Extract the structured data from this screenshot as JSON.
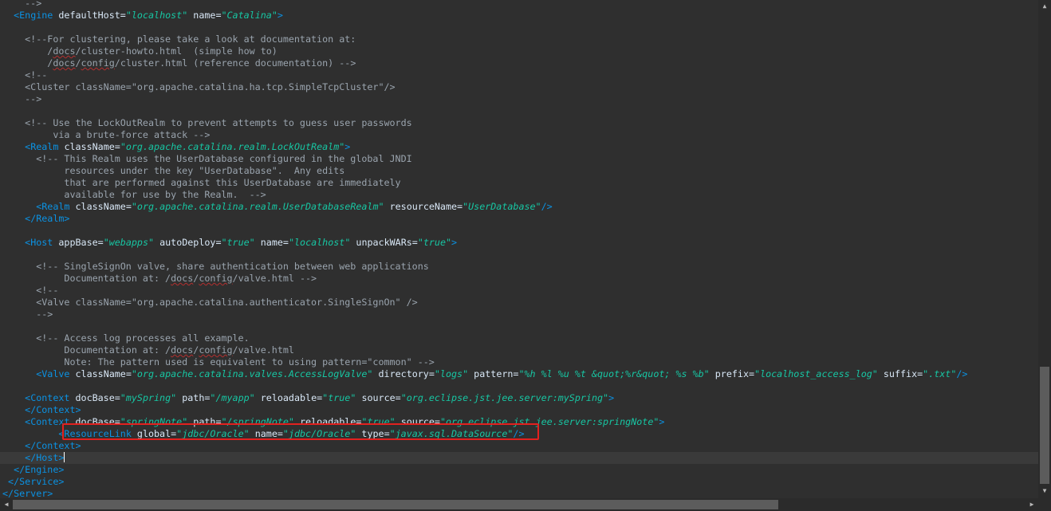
{
  "editor": {
    "lines": [
      [
        {
          "c": "ck",
          "t": "    -->"
        }
      ],
      [
        {
          "c": "t",
          "t": "  "
        },
        {
          "c": "tg",
          "t": "<Engine"
        },
        {
          "c": "t",
          "t": " "
        },
        {
          "c": "at",
          "t": "defaultHost="
        },
        {
          "c": "av",
          "t": "\"localhost\""
        },
        {
          "c": "t",
          "t": " "
        },
        {
          "c": "at",
          "t": "name="
        },
        {
          "c": "av",
          "t": "\"Catalina\""
        },
        {
          "c": "tg",
          "t": ">"
        }
      ],
      [
        {
          "c": "t",
          "t": ""
        }
      ],
      [
        {
          "c": "ck",
          "t": "    <!--For clustering, please take a look at documentation at:"
        }
      ],
      [
        {
          "c": "ck",
          "t": "        /"
        },
        {
          "c": "sq",
          "t": "docs"
        },
        {
          "c": "ck",
          "t": "/cluster-howto.html  (simple how to)"
        }
      ],
      [
        {
          "c": "ck",
          "t": "        /"
        },
        {
          "c": "sq",
          "t": "docs"
        },
        {
          "c": "ck",
          "t": "/"
        },
        {
          "c": "sq",
          "t": "config"
        },
        {
          "c": "ck",
          "t": "/cluster.html (reference documentation) -->"
        }
      ],
      [
        {
          "c": "ck",
          "t": "    <!--"
        }
      ],
      [
        {
          "c": "ck",
          "t": "    <Cluster className=\"org.apache.catalina.ha.tcp.SimpleTcpCluster\"/>"
        }
      ],
      [
        {
          "c": "ck",
          "t": "    -->"
        }
      ],
      [
        {
          "c": "t",
          "t": ""
        }
      ],
      [
        {
          "c": "ck",
          "t": "    <!-- Use the LockOutRealm to prevent attempts to guess user passwords"
        }
      ],
      [
        {
          "c": "ck",
          "t": "         via a brute-force attack -->"
        }
      ],
      [
        {
          "c": "t",
          "t": "    "
        },
        {
          "c": "tg",
          "t": "<Realm"
        },
        {
          "c": "t",
          "t": " "
        },
        {
          "c": "at",
          "t": "className="
        },
        {
          "c": "av",
          "t": "\"org.apache.catalina.realm.LockOutRealm\""
        },
        {
          "c": "tg",
          "t": ">"
        }
      ],
      [
        {
          "c": "ck",
          "t": "      <!-- This Realm uses the UserDatabase configured in the global JNDI"
        }
      ],
      [
        {
          "c": "ck",
          "t": "           resources under the key \"UserDatabase\".  Any edits"
        }
      ],
      [
        {
          "c": "ck",
          "t": "           that are performed against this UserDatabase are immediately"
        }
      ],
      [
        {
          "c": "ck",
          "t": "           available for use by the Realm.  -->"
        }
      ],
      [
        {
          "c": "t",
          "t": "      "
        },
        {
          "c": "tg",
          "t": "<Realm"
        },
        {
          "c": "t",
          "t": " "
        },
        {
          "c": "at",
          "t": "className="
        },
        {
          "c": "av",
          "t": "\"org.apache.catalina.realm.UserDatabaseRealm\""
        },
        {
          "c": "t",
          "t": " "
        },
        {
          "c": "at",
          "t": "resourceName="
        },
        {
          "c": "av",
          "t": "\"UserDatabase\""
        },
        {
          "c": "tg",
          "t": "/>"
        }
      ],
      [
        {
          "c": "t",
          "t": "    "
        },
        {
          "c": "tg",
          "t": "</Realm>"
        }
      ],
      [
        {
          "c": "t",
          "t": ""
        }
      ],
      [
        {
          "c": "t",
          "t": "    "
        },
        {
          "c": "tg",
          "t": "<Host"
        },
        {
          "c": "t",
          "t": " "
        },
        {
          "c": "at",
          "t": "appBase="
        },
        {
          "c": "av",
          "t": "\"webapps\""
        },
        {
          "c": "t",
          "t": " "
        },
        {
          "c": "at",
          "t": "autoDeploy="
        },
        {
          "c": "av",
          "t": "\"true\""
        },
        {
          "c": "t",
          "t": " "
        },
        {
          "c": "at",
          "t": "name="
        },
        {
          "c": "av",
          "t": "\"localhost\""
        },
        {
          "c": "t",
          "t": " "
        },
        {
          "c": "at",
          "t": "unpackWARs="
        },
        {
          "c": "av",
          "t": "\"true\""
        },
        {
          "c": "tg",
          "t": ">"
        }
      ],
      [
        {
          "c": "t",
          "t": ""
        }
      ],
      [
        {
          "c": "ck",
          "t": "      <!-- SingleSignOn valve, share authentication between web applications"
        }
      ],
      [
        {
          "c": "ck",
          "t": "           Documentation at: /"
        },
        {
          "c": "sq",
          "t": "docs"
        },
        {
          "c": "ck",
          "t": "/"
        },
        {
          "c": "sq",
          "t": "config"
        },
        {
          "c": "ck",
          "t": "/valve.html -->"
        }
      ],
      [
        {
          "c": "ck",
          "t": "      <!--"
        }
      ],
      [
        {
          "c": "ck",
          "t": "      <Valve className=\"org.apache.catalina.authenticator.SingleSignOn\" />"
        }
      ],
      [
        {
          "c": "ck",
          "t": "      -->"
        }
      ],
      [
        {
          "c": "t",
          "t": ""
        }
      ],
      [
        {
          "c": "ck",
          "t": "      <!-- Access log processes all example."
        }
      ],
      [
        {
          "c": "ck",
          "t": "           Documentation at: /"
        },
        {
          "c": "sq",
          "t": "docs"
        },
        {
          "c": "ck",
          "t": "/"
        },
        {
          "c": "sq",
          "t": "config"
        },
        {
          "c": "ck",
          "t": "/valve.html"
        }
      ],
      [
        {
          "c": "ck",
          "t": "           Note: The pattern used is equivalent to using pattern=\"common\" -->"
        }
      ],
      [
        {
          "c": "t",
          "t": "      "
        },
        {
          "c": "tg",
          "t": "<Valve"
        },
        {
          "c": "t",
          "t": " "
        },
        {
          "c": "at",
          "t": "className="
        },
        {
          "c": "av",
          "t": "\"org.apache.catalina.valves.AccessLogValve\""
        },
        {
          "c": "t",
          "t": " "
        },
        {
          "c": "at",
          "t": "directory="
        },
        {
          "c": "av",
          "t": "\"logs\""
        },
        {
          "c": "t",
          "t": " "
        },
        {
          "c": "at",
          "t": "pattern="
        },
        {
          "c": "av",
          "t": "\"%h %l %u %t &quot;%r&quot; %s %b\""
        },
        {
          "c": "t",
          "t": " "
        },
        {
          "c": "at",
          "t": "prefix="
        },
        {
          "c": "av",
          "t": "\"localhost_access_log\""
        },
        {
          "c": "t",
          "t": " "
        },
        {
          "c": "at",
          "t": "suffix="
        },
        {
          "c": "av",
          "t": "\".txt\""
        },
        {
          "c": "tg",
          "t": "/>"
        }
      ],
      [
        {
          "c": "t",
          "t": ""
        }
      ],
      [
        {
          "c": "t",
          "t": "    "
        },
        {
          "c": "tg",
          "t": "<Context"
        },
        {
          "c": "t",
          "t": " "
        },
        {
          "c": "at",
          "t": "docBase="
        },
        {
          "c": "av",
          "t": "\"mySpring\""
        },
        {
          "c": "t",
          "t": " "
        },
        {
          "c": "at",
          "t": "path="
        },
        {
          "c": "av",
          "t": "\"/myapp\""
        },
        {
          "c": "t",
          "t": " "
        },
        {
          "c": "at",
          "t": "reloadable="
        },
        {
          "c": "av",
          "t": "\"true\""
        },
        {
          "c": "t",
          "t": " "
        },
        {
          "c": "at",
          "t": "source="
        },
        {
          "c": "av",
          "t": "\"org.eclipse.jst.jee.server:mySpring\""
        },
        {
          "c": "tg",
          "t": ">"
        }
      ],
      [
        {
          "c": "t",
          "t": "    "
        },
        {
          "c": "tg",
          "t": "</Context>"
        }
      ],
      [
        {
          "c": "t",
          "t": "    "
        },
        {
          "c": "tg",
          "t": "<Context"
        },
        {
          "c": "t",
          "t": " "
        },
        {
          "c": "at",
          "t": "docBase="
        },
        {
          "c": "av",
          "t": "\"springNote\""
        },
        {
          "c": "t",
          "t": " "
        },
        {
          "c": "at",
          "t": "path="
        },
        {
          "c": "av",
          "t": "\"/springNote\""
        },
        {
          "c": "t",
          "t": " "
        },
        {
          "c": "at",
          "t": "reloadable="
        },
        {
          "c": "av",
          "t": "\"true\""
        },
        {
          "c": "t",
          "t": " "
        },
        {
          "c": "at",
          "t": "source="
        },
        {
          "c": "av",
          "t": "\"org.eclipse.jst.jee.server:springNote\""
        },
        {
          "c": "tg",
          "t": ">"
        }
      ],
      [
        {
          "c": "t",
          "t": "          "
        },
        {
          "c": "tg",
          "t": "<ResourceLink"
        },
        {
          "c": "t",
          "t": " "
        },
        {
          "c": "at",
          "t": "global="
        },
        {
          "c": "av",
          "t": "\"jdbc/Oracle\""
        },
        {
          "c": "t",
          "t": " "
        },
        {
          "c": "at",
          "t": "name="
        },
        {
          "c": "av",
          "t": "\"jdbc/Oracle\""
        },
        {
          "c": "t",
          "t": " "
        },
        {
          "c": "at",
          "t": "type="
        },
        {
          "c": "av",
          "t": "\"javax.sql.DataSource\""
        },
        {
          "c": "tg",
          "t": "/>"
        }
      ],
      [
        {
          "c": "t",
          "t": "    "
        },
        {
          "c": "tg",
          "t": "</Context>"
        }
      ],
      [
        {
          "c": "t",
          "t": "    "
        },
        {
          "c": "tg",
          "t": "</Host>"
        },
        {
          "c": "caret",
          "t": ""
        }
      ],
      [
        {
          "c": "t",
          "t": "  "
        },
        {
          "c": "tg",
          "t": "</Engine>"
        }
      ],
      [
        {
          "c": "t",
          "t": " "
        },
        {
          "c": "tg",
          "t": "</Service>"
        }
      ],
      [
        {
          "c": "tg",
          "t": "</Server>"
        }
      ]
    ],
    "current_line_index": 38,
    "highlighted_line_index": 36
  },
  "colors": {
    "background": "#2f2f2f",
    "tag": "#0b92e3",
    "comment": "#9aa4ae",
    "attribute": "#d9e8f7",
    "attribute_value": "#17c6a3",
    "highlight_box": "#e3211f"
  },
  "scrollbars": {
    "vertical": {
      "up_icon": "triangle-up-icon",
      "down_icon": "triangle-down-icon"
    },
    "horizontal": {
      "left_icon": "triangle-left-icon",
      "right_icon": "triangle-right-icon"
    }
  }
}
